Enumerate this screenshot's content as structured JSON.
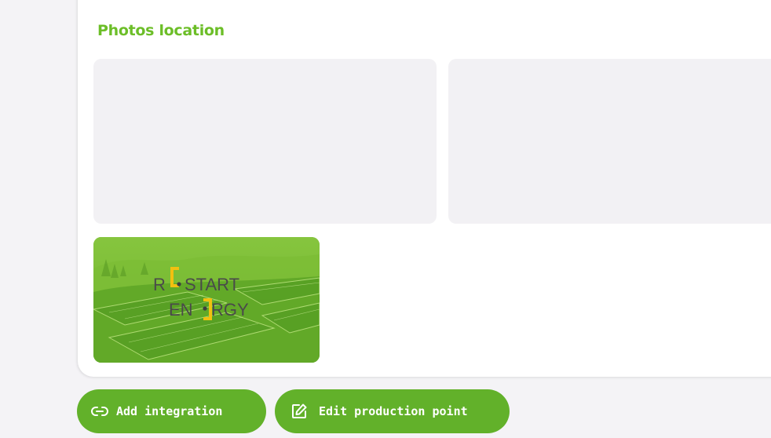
{
  "section": {
    "title": "Photos location"
  },
  "photo": {
    "logo_line1": [
      "R",
      "START"
    ],
    "logo_line2": [
      "EN",
      "RGY"
    ]
  },
  "actions": {
    "add_integration_label": "Add integration",
    "edit_production_point_label": "Edit production point"
  },
  "icons": {
    "add_integration": "link-icon",
    "edit_production_point": "edit-square-icon"
  },
  "colors": {
    "accent": "#6cbe28",
    "button": "#62b12a",
    "logo_bracket": "#f2c010",
    "logo_text": "#4a4a4a"
  }
}
